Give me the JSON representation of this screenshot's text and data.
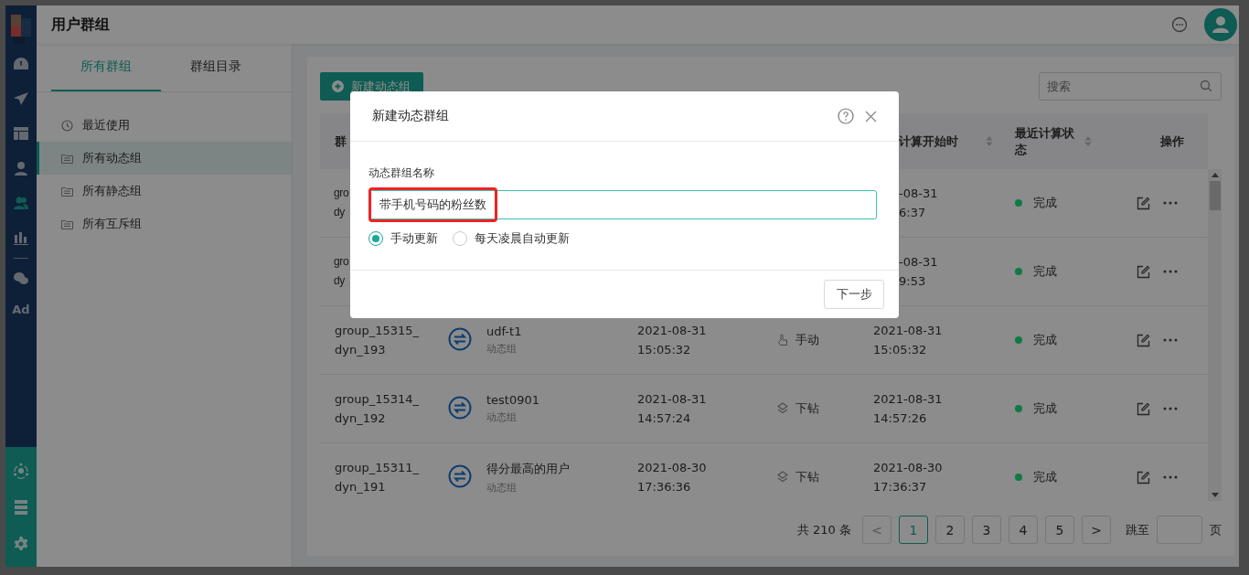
{
  "header": {
    "title": "用户群组"
  },
  "nav": {
    "items": [
      {
        "selected": false
      },
      {
        "selected": false
      },
      {
        "selected": false
      },
      {
        "selected": false
      },
      {
        "selected": true
      },
      {
        "selected": false
      },
      {
        "selected": false
      }
    ],
    "ad_label": "Ad"
  },
  "left_panel": {
    "tabs": [
      {
        "label": "所有群组",
        "selected": true
      },
      {
        "label": "群组目录",
        "selected": false
      }
    ],
    "items": [
      {
        "label": "最近使用",
        "kind": "recent",
        "selected": false
      },
      {
        "label": "所有动态组",
        "kind": "folder",
        "selected": true
      },
      {
        "label": "所有静态组",
        "kind": "folder",
        "selected": false
      },
      {
        "label": "所有互斥组",
        "kind": "folder",
        "selected": false
      }
    ]
  },
  "toolbar": {
    "new_button": "新建动态组",
    "search": {
      "placeholder": "搜索"
    }
  },
  "table": {
    "columns": [
      {
        "label": "群",
        "sortable": false
      },
      {
        "label": "计算开始时",
        "sortable": true
      },
      {
        "label": "最近计算状态",
        "sortable": true
      },
      {
        "label": "操作",
        "sortable": false
      }
    ],
    "rows": [
      {
        "id": [
          "gro",
          "dy"
        ],
        "last_computed": [
          "-08-31",
          "6:37"
        ],
        "status": "完成",
        "color": "#0f7a45"
      },
      {
        "id": [
          "gro",
          "dy"
        ],
        "last_computed": [
          "-08-31",
          "9:53"
        ],
        "status": "完成",
        "color": "#0f7a45"
      },
      {
        "id": [
          "group_15315_",
          "dyn_193"
        ],
        "name": "udf-t1",
        "subtitle": "动态组",
        "created": [
          "2021-08-31",
          "15:05:32"
        ],
        "kind": "manual",
        "type": "手动",
        "last_computed": [
          "2021-08-31",
          "15:05:32"
        ],
        "status": "完成",
        "color": "#0f7a45"
      },
      {
        "id": [
          "group_15314_",
          "dyn_192"
        ],
        "name": "test0901",
        "subtitle": "动态组",
        "created": [
          "2021-08-31",
          "14:57:24"
        ],
        "kind": "drill",
        "type": "下钻",
        "last_computed": [
          "2021-08-31",
          "14:57:26"
        ],
        "status": "完成",
        "color": "#0f7a45"
      },
      {
        "id": [
          "group_15311_",
          "dyn_191"
        ],
        "name": "得分最高的用户",
        "subtitle": "动态组",
        "created": [
          "2021-08-30",
          "17:36:36"
        ],
        "kind": "drill",
        "type": "下钻",
        "last_computed": [
          "2021-08-30",
          "17:36:37"
        ],
        "status": "完成",
        "color": "#0f7a45"
      }
    ]
  },
  "pagination": {
    "total": "共 210 条",
    "prev": "<",
    "pages": [
      {
        "label": "1",
        "selected": true
      },
      {
        "label": "2",
        "selected": false
      },
      {
        "label": "3",
        "selected": false
      },
      {
        "label": "4",
        "selected": false
      },
      {
        "label": "5",
        "selected": false
      }
    ],
    "next": ">",
    "jump_label": "跳至",
    "page_label": "页"
  },
  "dialog": {
    "title": "新建动态群组",
    "field_label": "动态群组名称",
    "value": "带手机号码的粉丝数",
    "highlighted": true,
    "options": [
      {
        "label": "手动更新",
        "selected": true
      },
      {
        "label": "每天凌晨自动更新",
        "selected": false
      }
    ],
    "next_button": "下一步"
  }
}
